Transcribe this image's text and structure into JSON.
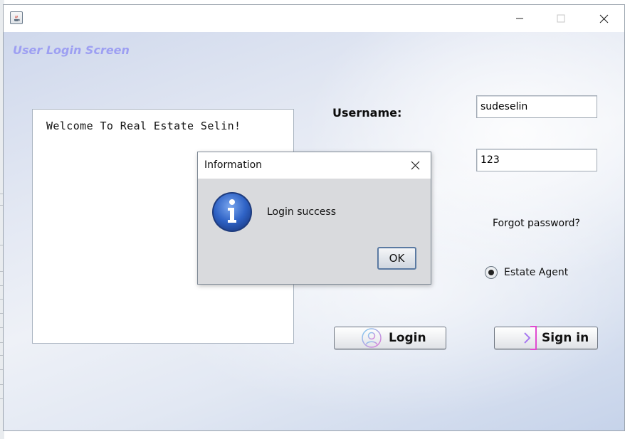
{
  "window": {
    "title": "",
    "controls": [
      "minimize-icon",
      "maximize-icon",
      "close-icon"
    ]
  },
  "login_screen": {
    "title": "User Login Screen",
    "welcome_text": "Welcome To Real Estate Selin!",
    "username_label": "Username:",
    "username_value": "sudeselin",
    "password_value": "123",
    "forgot_password": "Forgot password?",
    "role_option": {
      "label": "Estate Agent",
      "selected": true
    },
    "login_button": {
      "label": "Login",
      "icon": "user-avatar-icon"
    },
    "signin_button": {
      "label": "Sign in",
      "icon": "sign-in-arrow-icon"
    }
  },
  "dialog": {
    "title": "Information",
    "icon": "info-icon",
    "message": "Login success",
    "ok_label": "OK"
  },
  "colors": {
    "title_accent": "#9d9ff2",
    "ok_border": "#5b7aa2"
  }
}
